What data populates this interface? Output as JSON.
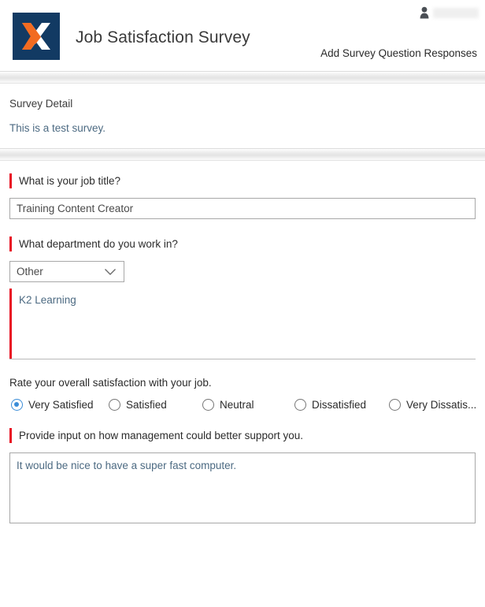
{
  "header": {
    "logo_icon": "k2-x-logo",
    "logo_colors": {
      "background": "#123a63",
      "orange": "#f26b21",
      "white": "#ffffff"
    },
    "title": "Job Satisfaction Survey",
    "user_icon": "person-icon",
    "user_name": "",
    "action_link": "Add Survey Question Responses"
  },
  "detail": {
    "title": "Survey Detail",
    "description": "This is a test survey."
  },
  "questions": {
    "job_title": {
      "label": "What is your job title?",
      "required": true,
      "value": "Training Content Creator",
      "placeholder": ""
    },
    "department": {
      "label": "What department do you work in?",
      "required": true,
      "selected": "Other",
      "chevron_icon": "chevron-down-icon",
      "comment": {
        "required": true,
        "value": "K2 Learning"
      }
    },
    "satisfaction": {
      "label": "Rate your overall satisfaction with your job.",
      "required": false,
      "options": [
        {
          "label": "Very Satisfied",
          "selected": true
        },
        {
          "label": "Satisfied",
          "selected": false
        },
        {
          "label": "Neutral",
          "selected": false
        },
        {
          "label": "Dissatisfied",
          "selected": false
        },
        {
          "label": "Very Dissatis...",
          "selected": false
        }
      ]
    },
    "management_input": {
      "label": "Provide input on how management could better support you.",
      "required": true,
      "value": "It would be nice to have a super fast computer.",
      "placeholder": ""
    }
  },
  "colors": {
    "required_bar": "#e81123",
    "radio_selected": "#3b8dd8",
    "text_value": "#4c6a82"
  }
}
